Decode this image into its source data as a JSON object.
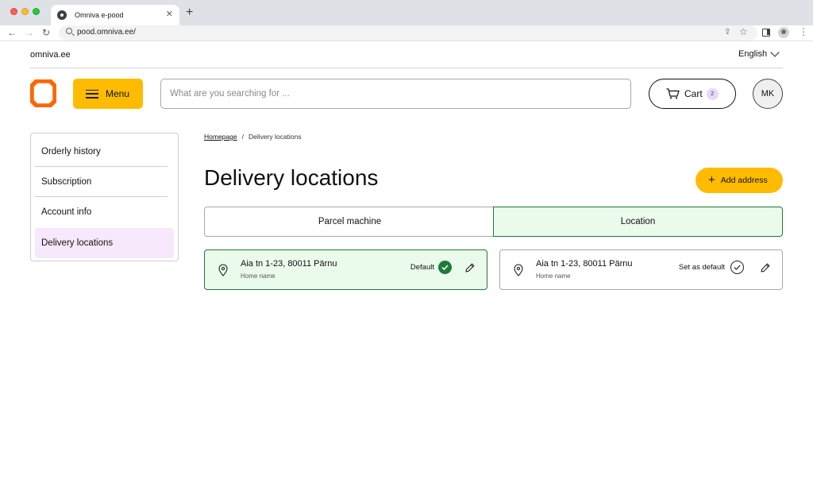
{
  "browser": {
    "tab_title": "Omniva e-pood",
    "tab_close": "✕",
    "new_tab": "+",
    "url": "pood.omniva.ee/"
  },
  "site": {
    "domain": "omniva.ee",
    "language": "English"
  },
  "header": {
    "menu_label": "Menu",
    "search_placeholder": "What are you searching for ...",
    "cart_label": "Cart",
    "cart_count": "2",
    "avatar_initials": "MK"
  },
  "colors": {
    "brand_orange": "#ff6600",
    "accent_yellow": "#ffbb00",
    "selected_green": "#1f7a3a",
    "selected_bg": "#eafbeb",
    "sidebar_active_bg": "#f8e8fb"
  },
  "sidebar": {
    "items": [
      {
        "label": "Orderly history",
        "active": false
      },
      {
        "label": "Subscription",
        "active": false
      },
      {
        "label": "Account info",
        "active": false
      },
      {
        "label": "Delivery locations",
        "active": true
      }
    ]
  },
  "breadcrumb": {
    "home": "Homepage",
    "separator": "/",
    "current": "Delivery locations"
  },
  "page": {
    "title": "Delivery locations",
    "add_address": "Add address"
  },
  "tabs": [
    {
      "label": "Parcel machine",
      "selected": false
    },
    {
      "label": "Location",
      "selected": true
    }
  ],
  "addresses": [
    {
      "address": "Aia tn 1-23, 80011 Pärnu",
      "name": "Home name",
      "status": "Default",
      "is_default": true
    },
    {
      "address": "Aia tn 1-23, 80011 Pärnu",
      "name": "Home name",
      "status": "Set as default",
      "is_default": false
    }
  ]
}
